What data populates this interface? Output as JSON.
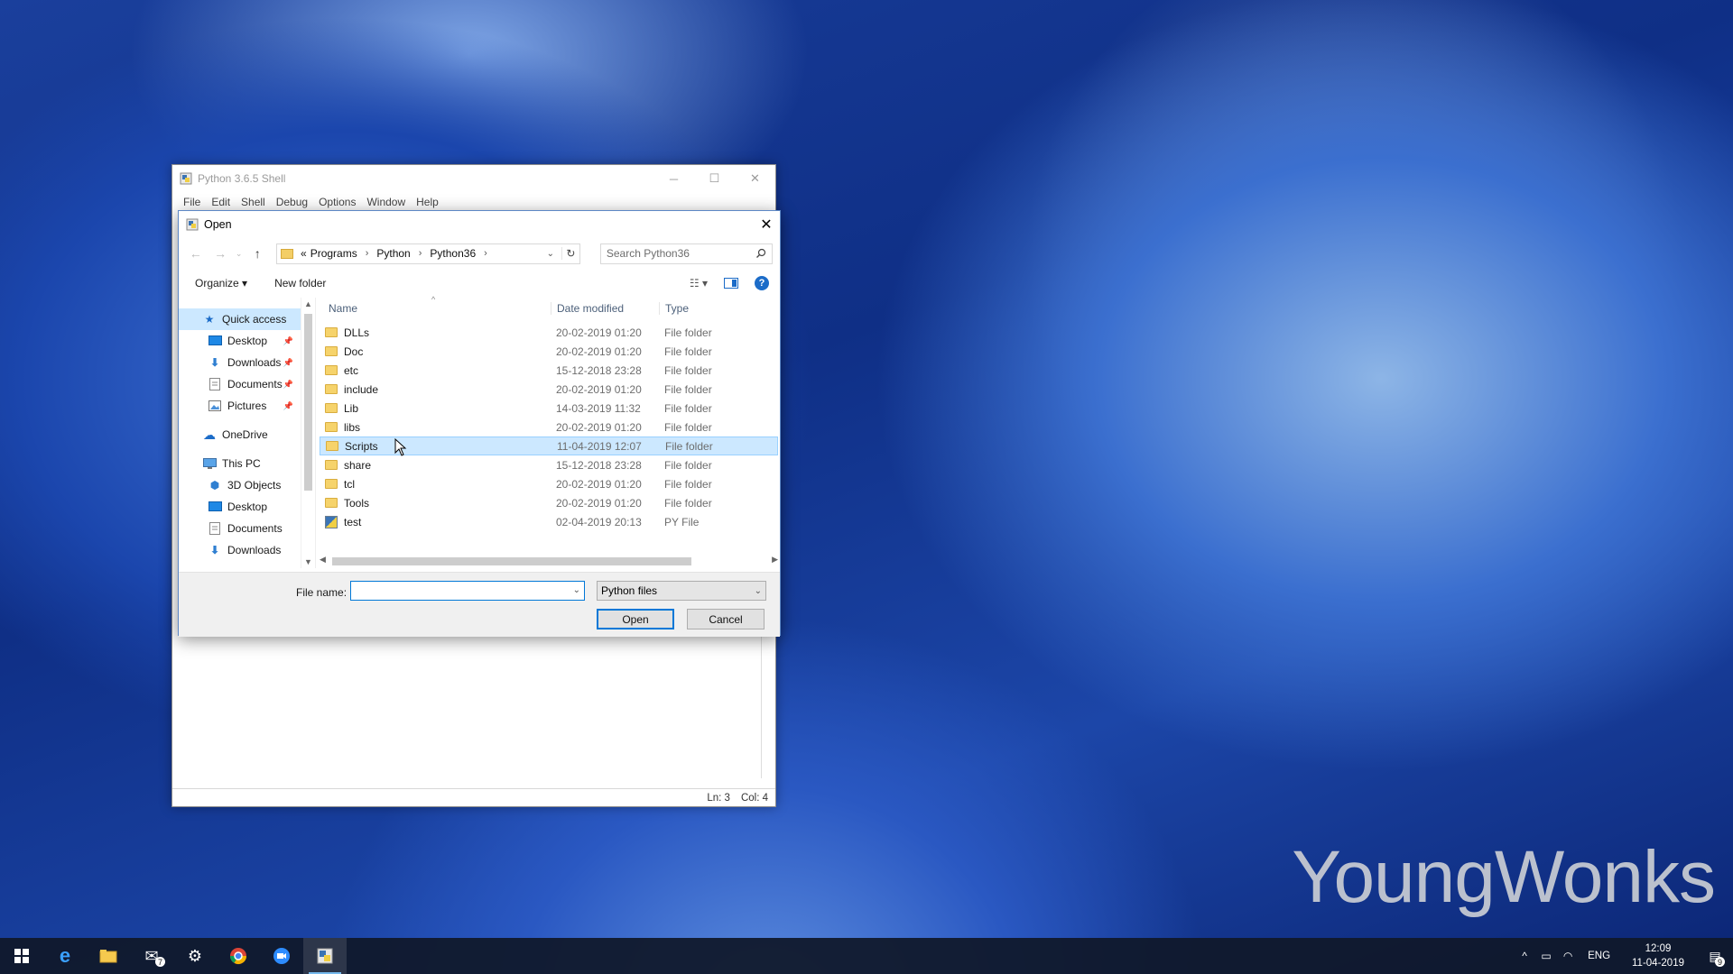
{
  "shell": {
    "title": "Python 3.6.5 Shell",
    "menu": [
      "File",
      "Edit",
      "Shell",
      "Debug",
      "Options",
      "Window",
      "Help"
    ],
    "status": {
      "line": "Ln: 3",
      "col": "Col: 4"
    }
  },
  "dialog": {
    "title": "Open",
    "breadcrumb": {
      "prefix": "«",
      "items": [
        "Programs",
        "Python",
        "Python36"
      ]
    },
    "search_placeholder": "Search Python36",
    "toolbar": {
      "organize": "Organize ▾",
      "new_folder": "New folder"
    },
    "nav": {
      "quick_access": "Quick access",
      "quick_items": [
        "Desktop",
        "Downloads",
        "Documents",
        "Pictures"
      ],
      "onedrive": "OneDrive",
      "this_pc": "This PC",
      "pc_items": [
        "3D Objects",
        "Desktop",
        "Documents",
        "Downloads"
      ]
    },
    "columns": {
      "name": "Name",
      "date": "Date modified",
      "type": "Type"
    },
    "files": [
      {
        "name": "DLLs",
        "date": "20-02-2019 01:20",
        "type": "File folder"
      },
      {
        "name": "Doc",
        "date": "20-02-2019 01:20",
        "type": "File folder"
      },
      {
        "name": "etc",
        "date": "15-12-2018 23:28",
        "type": "File folder"
      },
      {
        "name": "include",
        "date": "20-02-2019 01:20",
        "type": "File folder"
      },
      {
        "name": "Lib",
        "date": "14-03-2019 11:32",
        "type": "File folder"
      },
      {
        "name": "libs",
        "date": "20-02-2019 01:20",
        "type": "File folder"
      },
      {
        "name": "Scripts",
        "date": "11-04-2019 12:07",
        "type": "File folder",
        "selected": true
      },
      {
        "name": "share",
        "date": "15-12-2018 23:28",
        "type": "File folder"
      },
      {
        "name": "tcl",
        "date": "20-02-2019 01:20",
        "type": "File folder"
      },
      {
        "name": "Tools",
        "date": "20-02-2019 01:20",
        "type": "File folder"
      },
      {
        "name": "test",
        "date": "02-04-2019 20:13",
        "type": "PY File"
      }
    ],
    "filename_label": "File name:",
    "filename_value": "",
    "filter": "Python files",
    "open_button": "Open",
    "cancel_button": "Cancel"
  },
  "watermark": "YoungWonks",
  "taskbar": {
    "mail_badge": "7",
    "lang": "ENG",
    "time": "12:09",
    "date": "11-04-2019",
    "notification_count": "9"
  }
}
